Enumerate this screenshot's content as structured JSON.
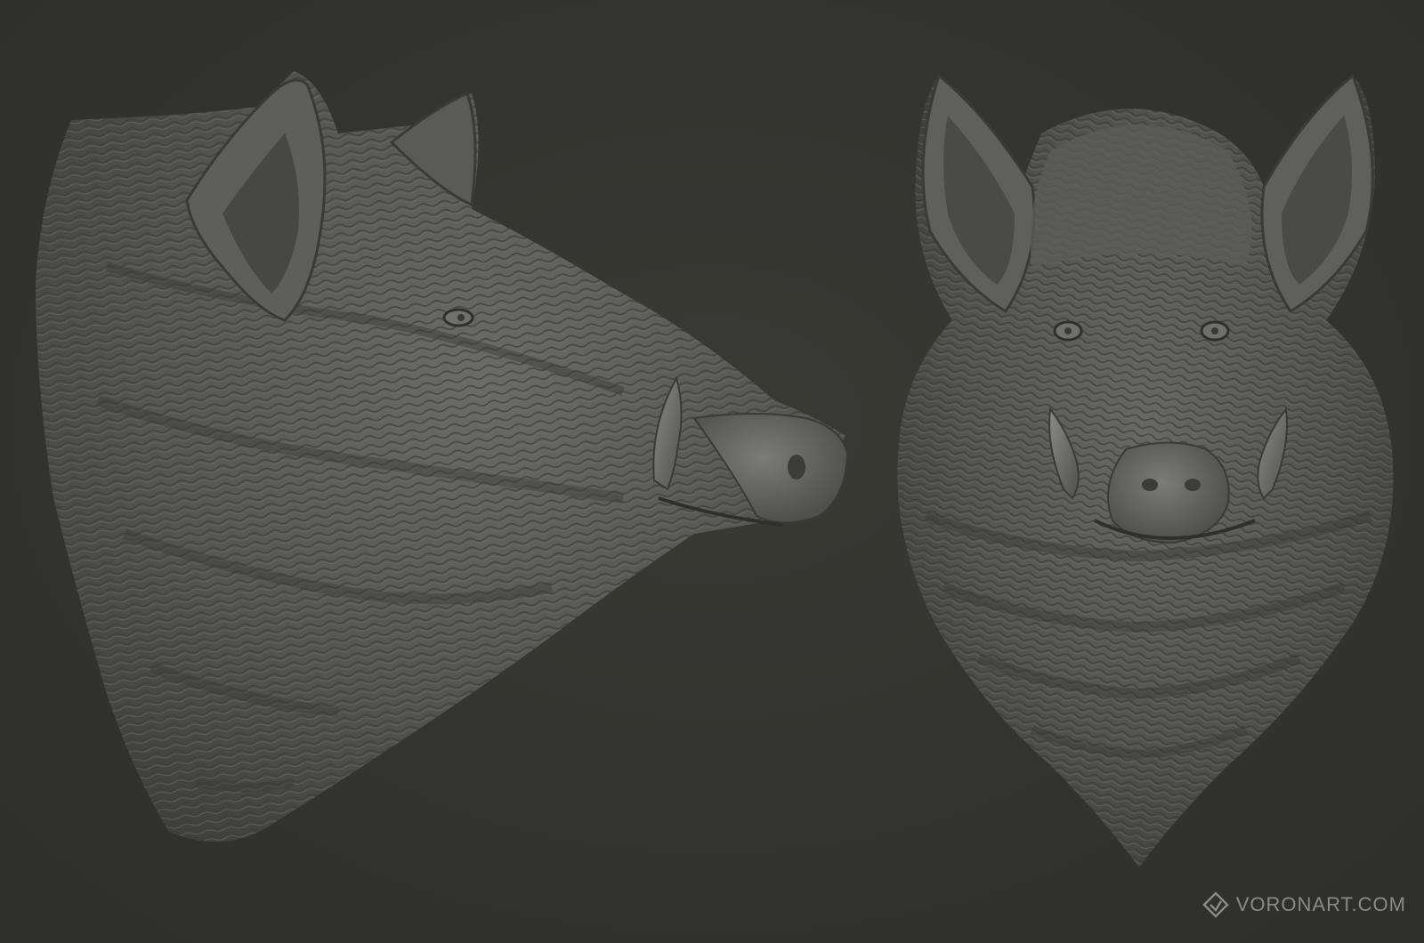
{
  "scene": {
    "background_color": "#33332f",
    "sculpt_color": "#5a5a57",
    "views": [
      {
        "name": "boar-head-side-view",
        "icon": "boar-head-profile"
      },
      {
        "name": "boar-head-front-view",
        "icon": "boar-head-front"
      }
    ]
  },
  "watermark": {
    "text": "VORONART.COM",
    "logo_icon": "voronart-logo-icon"
  }
}
